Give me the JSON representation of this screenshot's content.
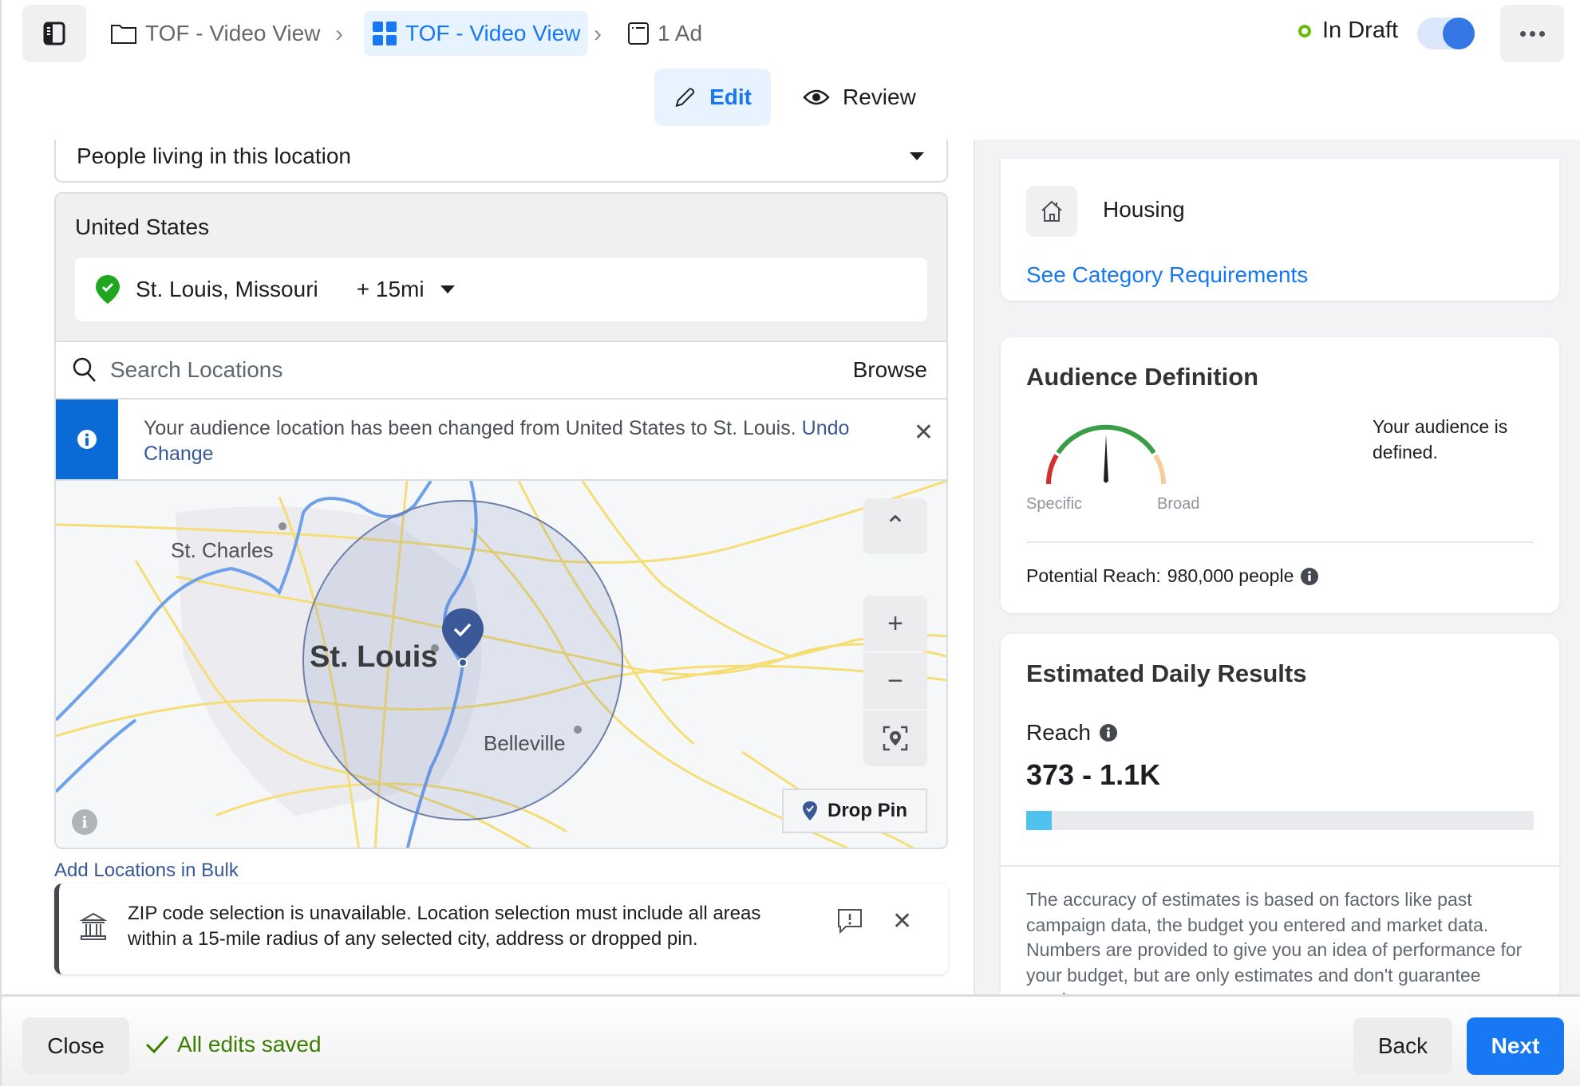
{
  "header": {
    "breadcrumbs": [
      {
        "label": "TOF - Video View",
        "icon": "folder-icon",
        "active": false
      },
      {
        "label": "TOF - Video View",
        "icon": "grid-icon",
        "active": true
      },
      {
        "label": "1 Ad",
        "icon": "ad-icon",
        "active": false
      }
    ],
    "status_label": "In Draft",
    "status_color": "#63be09",
    "toggle_on": true,
    "tabs": [
      {
        "label": "Edit",
        "icon": "pencil-icon",
        "active": true
      },
      {
        "label": "Review",
        "icon": "eye-icon",
        "active": false
      }
    ]
  },
  "location": {
    "type_select_value": "People living in this location",
    "country": "United States",
    "selected_location": "St. Louis, Missouri",
    "radius": "+ 15mi",
    "search_placeholder": "Search Locations",
    "browse_label": "Browse",
    "banner_text": "Your audience location has been changed from United States to St. Louis.",
    "banner_link": "Undo Change",
    "map": {
      "labels": [
        "St. Charles",
        "St. Louis",
        "Belleville"
      ],
      "drop_pin_label": "Drop Pin",
      "radius_miles": 15
    },
    "bulk_link": "Add Locations in Bulk",
    "zip_notice": "ZIP code selection is unavailable. Location selection must include all areas within a 15-mile radius of any selected city, address or dropped pin."
  },
  "right": {
    "category": {
      "label": "Housing",
      "link": "See Category Requirements"
    },
    "audience": {
      "title": "Audience Definition",
      "gauge_low_label": "Specific",
      "gauge_high_label": "Broad",
      "gauge_value_fraction": 0.5,
      "status_text": "Your audience is defined.",
      "potential_reach_label": "Potential Reach:",
      "potential_reach_value": "980,000 people"
    },
    "estimates": {
      "title": "Estimated Daily Results",
      "reach_label": "Reach",
      "reach_value": "373 - 1.1K",
      "reach_bar_fraction": 0.05,
      "bar_color": "#4fc3ed",
      "disclaimer": "The accuracy of estimates is based on factors like past campaign data, the budget you entered and market data. Numbers are provided to give you an idea of performance for your budget, but are only estimates and don't guarantee results."
    }
  },
  "footer": {
    "close_label": "Close",
    "saved_label": "All edits saved",
    "saved_color": "#3b7d00",
    "back_label": "Back",
    "next_label": "Next",
    "next_color": "#1877f2"
  }
}
